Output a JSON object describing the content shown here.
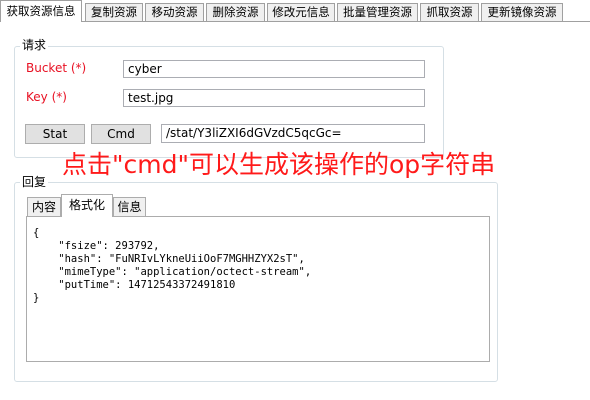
{
  "top_tabs": [
    {
      "label": "获取资源信息",
      "active": true
    },
    {
      "label": "复制资源",
      "active": false
    },
    {
      "label": "移动资源",
      "active": false
    },
    {
      "label": "删除资源",
      "active": false
    },
    {
      "label": "修改元信息",
      "active": false
    },
    {
      "label": "批量管理资源",
      "active": false
    },
    {
      "label": "抓取资源",
      "active": false
    },
    {
      "label": "更新镜像资源",
      "active": false
    }
  ],
  "request": {
    "title": "请求",
    "bucket_label": "Bucket (*)",
    "bucket_value": "cyber",
    "key_label": "Key (*)",
    "key_value": "test.jpg",
    "stat_button": "Stat",
    "cmd_button": "Cmd",
    "op_value": "/stat/Y3liZXI6dGVzdC5qcGc="
  },
  "annotation": "点击\"cmd\"可以生成该操作的op字符串",
  "response": {
    "title": "回复",
    "tabs": [
      {
        "label": "内容",
        "active": false
      },
      {
        "label": "格式化",
        "active": true
      },
      {
        "label": "信息",
        "active": false
      }
    ],
    "formatted_text": "{\n    \"fsize\": 293792,\n    \"hash\": \"FuNRIvLYkneUiiOoF7MGHHZYX2sT\",\n    \"mimeType\": \"application/octect-stream\",\n    \"putTime\": 14712543372491810\n}"
  },
  "colors": {
    "required_label": "#e81123",
    "annotation": "#ff1a1a",
    "group_border": "#d5dfe5"
  }
}
